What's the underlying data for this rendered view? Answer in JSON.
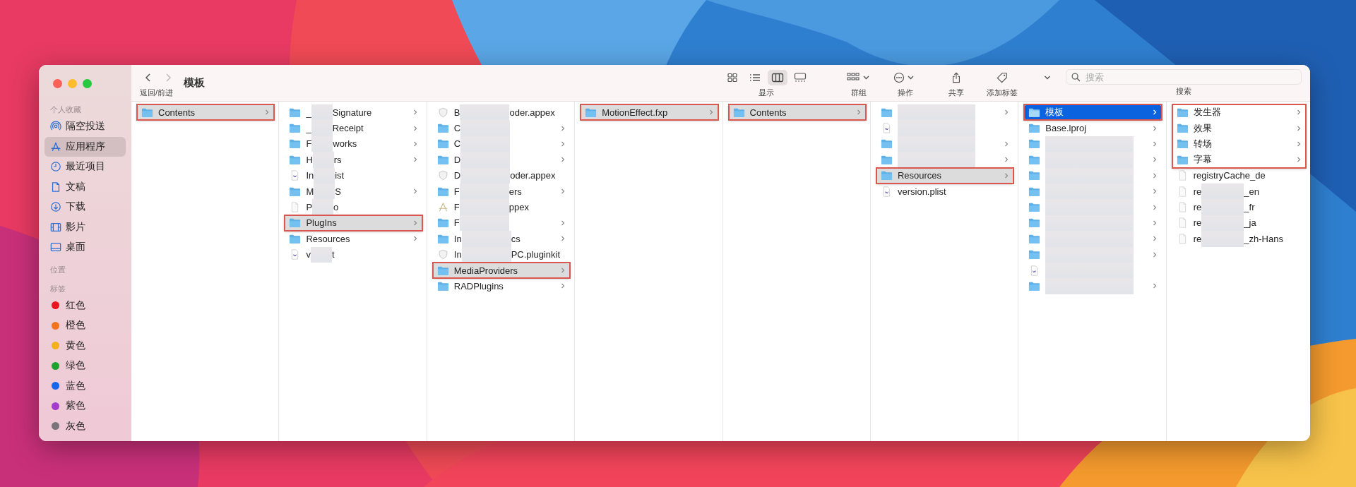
{
  "window": {
    "title": "模板"
  },
  "sidebar": {
    "sections": [
      {
        "heading": "个人收藏",
        "items": [
          {
            "label": "隔空投送",
            "selected": false
          },
          {
            "label": "应用程序",
            "selected": true
          },
          {
            "label": "最近项目",
            "selected": false
          },
          {
            "label": "文稿",
            "selected": false
          },
          {
            "label": "下载",
            "selected": false
          },
          {
            "label": "影片",
            "selected": false
          },
          {
            "label": "桌面",
            "selected": false
          }
        ]
      },
      {
        "heading": "位置"
      },
      {
        "heading": "标签",
        "tags": [
          {
            "label": "红色",
            "color": "#e9141d"
          },
          {
            "label": "橙色",
            "color": "#f0741e"
          },
          {
            "label": "黄色",
            "color": "#f4b01a"
          },
          {
            "label": "绿色",
            "color": "#1ea22f"
          },
          {
            "label": "蓝色",
            "color": "#1767ee"
          },
          {
            "label": "紫色",
            "color": "#a33ccd"
          },
          {
            "label": "灰色",
            "color": "#78747a"
          }
        ]
      }
    ]
  },
  "toolbar": {
    "nav_label": "返回/前进",
    "view_label": "显示",
    "view_modes": [
      {
        "selected": false
      },
      {
        "selected": false
      },
      {
        "selected": true
      },
      {
        "selected": false
      }
    ],
    "group_label": "群组",
    "action_label": "操作",
    "share_label": "共享",
    "tag_label": "添加标签",
    "search": {
      "placeholder": "搜索"
    },
    "search_label": "搜索"
  },
  "columns": [
    {
      "focused": false,
      "items": [
        {
          "kind": "folder",
          "name": "Contents",
          "selected": true,
          "annotated": true,
          "has_children": true
        }
      ]
    },
    {
      "focused": false,
      "items": [
        {
          "kind": "folder",
          "name": "_",
          "masked": true,
          "name_end": "Signature",
          "selected": false,
          "annotated": false,
          "has_children": true
        },
        {
          "kind": "folder",
          "name": "_",
          "masked": true,
          "name_end": "Receipt",
          "selected": false,
          "annotated": false,
          "has_children": true
        },
        {
          "kind": "folder",
          "name": "F",
          "masked": true,
          "name_end": "works",
          "selected": false,
          "annotated": false,
          "has_children": true
        },
        {
          "kind": "folder",
          "name": "H",
          "masked": true,
          "name_end": "rs",
          "selected": false,
          "annotated": false,
          "has_children": true
        },
        {
          "kind": "plist",
          "name": "In",
          "masked": true,
          "name_end": "ist",
          "selected": false,
          "annotated": false,
          "has_children": false
        },
        {
          "kind": "folder",
          "name": "M",
          "masked": true,
          "name_end": "S",
          "selected": false,
          "annotated": false,
          "has_children": true
        },
        {
          "kind": "doc",
          "name": "P",
          "masked": true,
          "name_end": "o",
          "selected": false,
          "annotated": false,
          "has_children": false
        },
        {
          "kind": "folder",
          "name": "PlugIns",
          "selected": true,
          "annotated": true,
          "has_children": true
        },
        {
          "kind": "folder",
          "name": "Resources",
          "selected": false,
          "annotated": false,
          "has_children": true
        },
        {
          "kind": "plist",
          "name": "v",
          "masked": true,
          "name_end": "t",
          "selected": false,
          "annotated": false,
          "has_children": false
        }
      ]
    },
    {
      "focused": false,
      "items": [
        {
          "kind": "appex",
          "name": "B",
          "masked": true,
          "name_end": "oder.appex",
          "selected": false,
          "annotated": false,
          "has_children": false
        },
        {
          "kind": "folder",
          "name": "C",
          "masked": true,
          "selected": false,
          "annotated": false,
          "has_children": true
        },
        {
          "kind": "folder",
          "name": "C",
          "masked": true,
          "selected": false,
          "annotated": false,
          "has_children": true
        },
        {
          "kind": "folder",
          "name": "D",
          "masked": true,
          "selected": false,
          "annotated": false,
          "has_children": true
        },
        {
          "kind": "appex",
          "name": "D",
          "masked": true,
          "name_end": "oder.appex",
          "selected": false,
          "annotated": false,
          "has_children": false
        },
        {
          "kind": "folder",
          "name": "F",
          "masked": true,
          "name_end": "ers",
          "selected": false,
          "annotated": false,
          "has_children": true
        },
        {
          "kind": "app",
          "name": "F",
          "masked": true,
          "name_end": "ppex",
          "selected": false,
          "annotated": false,
          "has_children": false
        },
        {
          "kind": "folder",
          "name": "F",
          "masked": true,
          "selected": false,
          "annotated": false,
          "has_children": true
        },
        {
          "kind": "folder",
          "name": "In",
          "masked": true,
          "name_end": "cs",
          "selected": false,
          "annotated": false,
          "has_children": true
        },
        {
          "kind": "appex",
          "name": "In",
          "masked": true,
          "name_end": "PC.pluginkit",
          "selected": false,
          "annotated": false,
          "has_children": false
        },
        {
          "kind": "folder",
          "name": "MediaProviders",
          "selected": true,
          "annotated": true,
          "has_children": true
        },
        {
          "kind": "folder",
          "name": "RADPlugins",
          "selected": false,
          "annotated": false,
          "has_children": true
        }
      ]
    },
    {
      "focused": false,
      "items": [
        {
          "kind": "folder",
          "name": "MotionEffect.fxp",
          "selected": true,
          "annotated": true,
          "has_children": true
        }
      ]
    },
    {
      "focused": false,
      "items": [
        {
          "kind": "folder",
          "name": "Contents",
          "selected": true,
          "annotated": true,
          "has_children": true
        }
      ]
    },
    {
      "focused": false,
      "items": [
        {
          "kind": "folder",
          "masked": true,
          "selected": false,
          "annotated": false,
          "has_children": true
        },
        {
          "kind": "plist",
          "masked": true,
          "selected": false,
          "annotated": false,
          "has_children": false
        },
        {
          "kind": "folder",
          "masked": true,
          "selected": false,
          "annotated": false,
          "has_children": true
        },
        {
          "kind": "folder",
          "masked": true,
          "selected": false,
          "annotated": false,
          "has_children": true
        },
        {
          "kind": "folder",
          "name": "Resources",
          "selected": true,
          "annotated": true,
          "has_children": true
        },
        {
          "kind": "plist",
          "name": "version.plist",
          "selected": false,
          "annotated": false,
          "has_children": false
        }
      ]
    },
    {
      "focused": true,
      "items": [
        {
          "kind": "folder",
          "name": "模板",
          "selected": true,
          "annotated": true,
          "has_children": true
        },
        {
          "kind": "folder",
          "name": "Base.lproj",
          "selected": false,
          "annotated": false,
          "has_children": true
        },
        {
          "kind": "folder",
          "masked": true,
          "selected": false,
          "annotated": false,
          "has_children": true
        },
        {
          "kind": "folder",
          "masked": true,
          "selected": false,
          "annotated": false,
          "has_children": true
        },
        {
          "kind": "folder",
          "masked": true,
          "selected": false,
          "annotated": false,
          "has_children": true
        },
        {
          "kind": "folder",
          "masked": true,
          "selected": false,
          "annotated": false,
          "has_children": true
        },
        {
          "kind": "folder",
          "masked": true,
          "selected": false,
          "annotated": false,
          "has_children": true
        },
        {
          "kind": "folder",
          "masked": true,
          "selected": false,
          "annotated": false,
          "has_children": true
        },
        {
          "kind": "folder",
          "masked": true,
          "selected": false,
          "annotated": false,
          "has_children": true
        },
        {
          "kind": "folder",
          "masked": true,
          "selected": false,
          "annotated": false,
          "has_children": true
        },
        {
          "kind": "plist",
          "masked": true,
          "selected": false,
          "annotated": false,
          "has_children": false
        },
        {
          "kind": "folder",
          "masked": true,
          "selected": false,
          "annotated": false,
          "has_children": true
        }
      ]
    },
    {
      "focused": false,
      "items": [
        {
          "kind": "folder",
          "name": "发生器",
          "selected": false,
          "annotated": true,
          "has_children": true
        },
        {
          "kind": "folder",
          "name": "效果",
          "selected": false,
          "annotated": true,
          "has_children": true
        },
        {
          "kind": "folder",
          "name": "转场",
          "selected": false,
          "annotated": true,
          "has_children": true
        },
        {
          "kind": "folder",
          "name": "字幕",
          "selected": false,
          "annotated": true,
          "has_children": true
        },
        {
          "kind": "doc",
          "name": "registryCache_de",
          "selected": false,
          "annotated": false,
          "has_children": false
        },
        {
          "kind": "doc",
          "name": "re",
          "masked": true,
          "name_end": "_en",
          "selected": false,
          "annotated": false,
          "has_children": false
        },
        {
          "kind": "doc",
          "name": "re",
          "masked": true,
          "name_end": "_fr",
          "selected": false,
          "annotated": false,
          "has_children": false
        },
        {
          "kind": "doc",
          "name": "re",
          "masked": true,
          "name_end": "_ja",
          "selected": false,
          "annotated": false,
          "has_children": false
        },
        {
          "kind": "doc",
          "name": "re",
          "masked": true,
          "name_end": "_zh-Hans",
          "selected": false,
          "annotated": false,
          "has_children": false
        }
      ]
    }
  ]
}
